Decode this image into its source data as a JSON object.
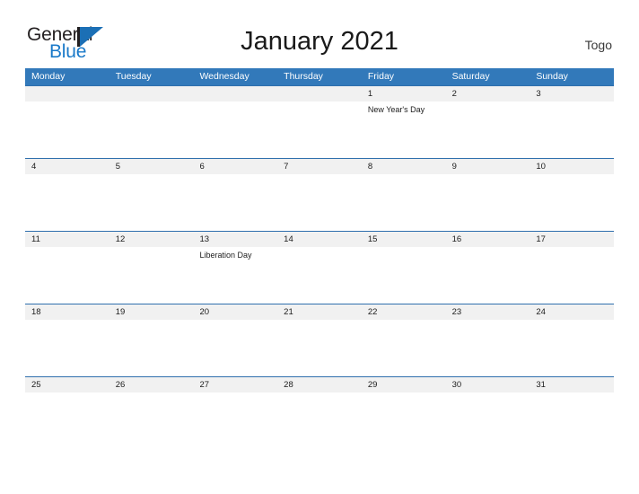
{
  "brand": {
    "name_part1": "General",
    "name_part2": "Blue",
    "flag_color": "#1b6fb5"
  },
  "header": {
    "title": "January 2021",
    "subject": "Togo"
  },
  "theme": {
    "header_blue": "#3279ba",
    "rule_blue": "#2f6fad",
    "band_gray": "#f1f1f1",
    "text_dark": "#1c1c1c",
    "brand_blue": "#1b7ac9"
  },
  "calendar": {
    "weekdays": [
      "Monday",
      "Tuesday",
      "Wednesday",
      "Thursday",
      "Friday",
      "Saturday",
      "Sunday"
    ],
    "weeks": [
      {
        "days": [
          {
            "date": "",
            "events": []
          },
          {
            "date": "",
            "events": []
          },
          {
            "date": "",
            "events": []
          },
          {
            "date": "",
            "events": []
          },
          {
            "date": "1",
            "events": [
              "New Year's Day"
            ]
          },
          {
            "date": "2",
            "events": []
          },
          {
            "date": "3",
            "events": []
          }
        ]
      },
      {
        "days": [
          {
            "date": "4",
            "events": []
          },
          {
            "date": "5",
            "events": []
          },
          {
            "date": "6",
            "events": []
          },
          {
            "date": "7",
            "events": []
          },
          {
            "date": "8",
            "events": []
          },
          {
            "date": "9",
            "events": []
          },
          {
            "date": "10",
            "events": []
          }
        ]
      },
      {
        "days": [
          {
            "date": "11",
            "events": []
          },
          {
            "date": "12",
            "events": []
          },
          {
            "date": "13",
            "events": [
              "Liberation Day"
            ]
          },
          {
            "date": "14",
            "events": []
          },
          {
            "date": "15",
            "events": []
          },
          {
            "date": "16",
            "events": []
          },
          {
            "date": "17",
            "events": []
          }
        ]
      },
      {
        "days": [
          {
            "date": "18",
            "events": []
          },
          {
            "date": "19",
            "events": []
          },
          {
            "date": "20",
            "events": []
          },
          {
            "date": "21",
            "events": []
          },
          {
            "date": "22",
            "events": []
          },
          {
            "date": "23",
            "events": []
          },
          {
            "date": "24",
            "events": []
          }
        ]
      },
      {
        "days": [
          {
            "date": "25",
            "events": []
          },
          {
            "date": "26",
            "events": []
          },
          {
            "date": "27",
            "events": []
          },
          {
            "date": "28",
            "events": []
          },
          {
            "date": "29",
            "events": []
          },
          {
            "date": "30",
            "events": []
          },
          {
            "date": "31",
            "events": []
          }
        ]
      }
    ]
  }
}
